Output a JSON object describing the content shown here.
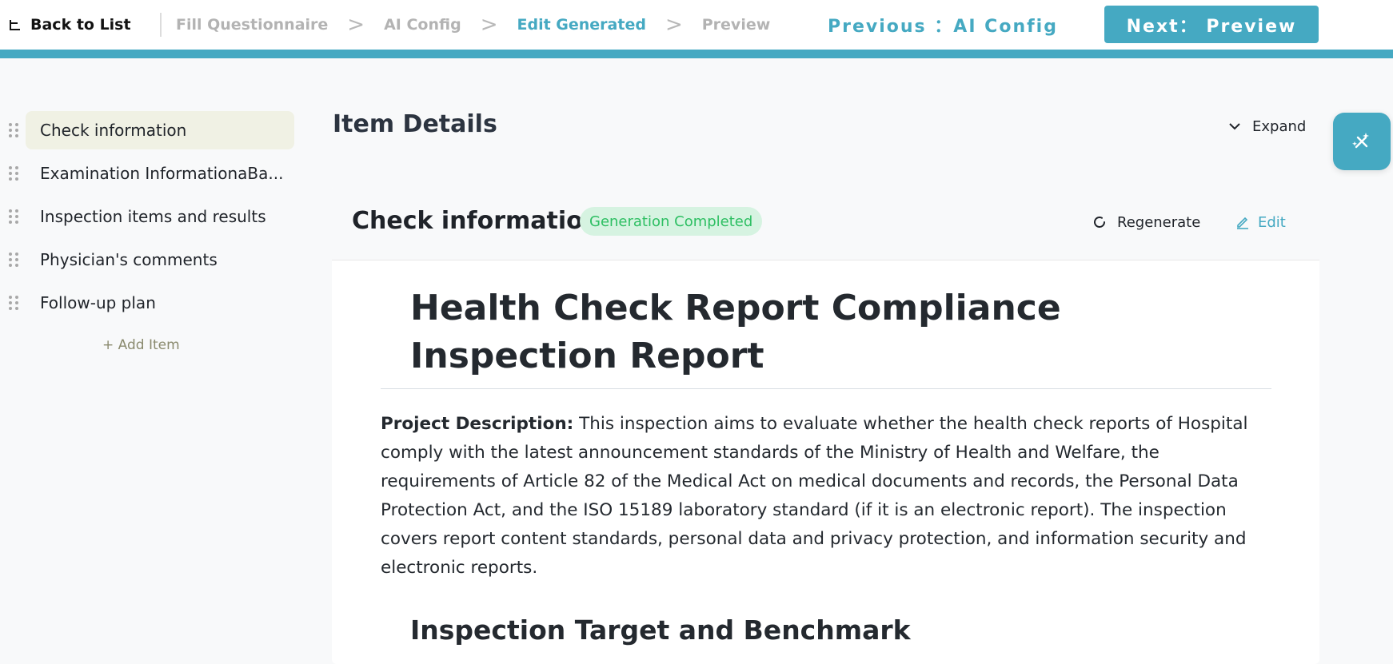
{
  "header": {
    "back_label": "Back to List",
    "steps": [
      {
        "label": "Fill Questionnaire"
      },
      {
        "label": "AI Config"
      },
      {
        "label": "Edit Generated"
      },
      {
        "label": "Preview"
      }
    ],
    "arrow": ">",
    "active_step_index": 2,
    "previous_label": "Previous ：AI Config",
    "next_label": "Next： Preview",
    "accent_color": "#45a9c2"
  },
  "sidebar": {
    "items": [
      {
        "label": "Check information",
        "active": true
      },
      {
        "label": "Examination InformationaBa..."
      },
      {
        "label": "Inspection items and results"
      },
      {
        "label": "Physician's comments"
      },
      {
        "label": "Follow-up plan"
      }
    ],
    "add_item_label": "+ Add Item"
  },
  "main": {
    "title": "Item Details",
    "expand_label": "Expand",
    "fab_icon": "magic-wand-icon",
    "card": {
      "title": "Check information",
      "status": "Generation Completed",
      "status_color": "#2ebf63",
      "regenerate_label": "Regenerate",
      "edit_label": "Edit",
      "doc": {
        "h1": "Health Check Report Compliance Inspection Report",
        "desc_label": "Project Description:",
        "desc_text": " This inspection aims to evaluate whether the health check reports of Hospital comply with the latest announcement standards of the Ministry of Health and Welfare, the requirements of Article 82 of the Medical Act on medical documents and records, the Personal Data Protection Act, and the ISO 15189 laboratory standard (if it is an electronic report). The inspection covers report content standards, personal data and privacy protection, and information security and electronic reports.",
        "h2": "Inspection Target and Benchmark"
      }
    }
  }
}
